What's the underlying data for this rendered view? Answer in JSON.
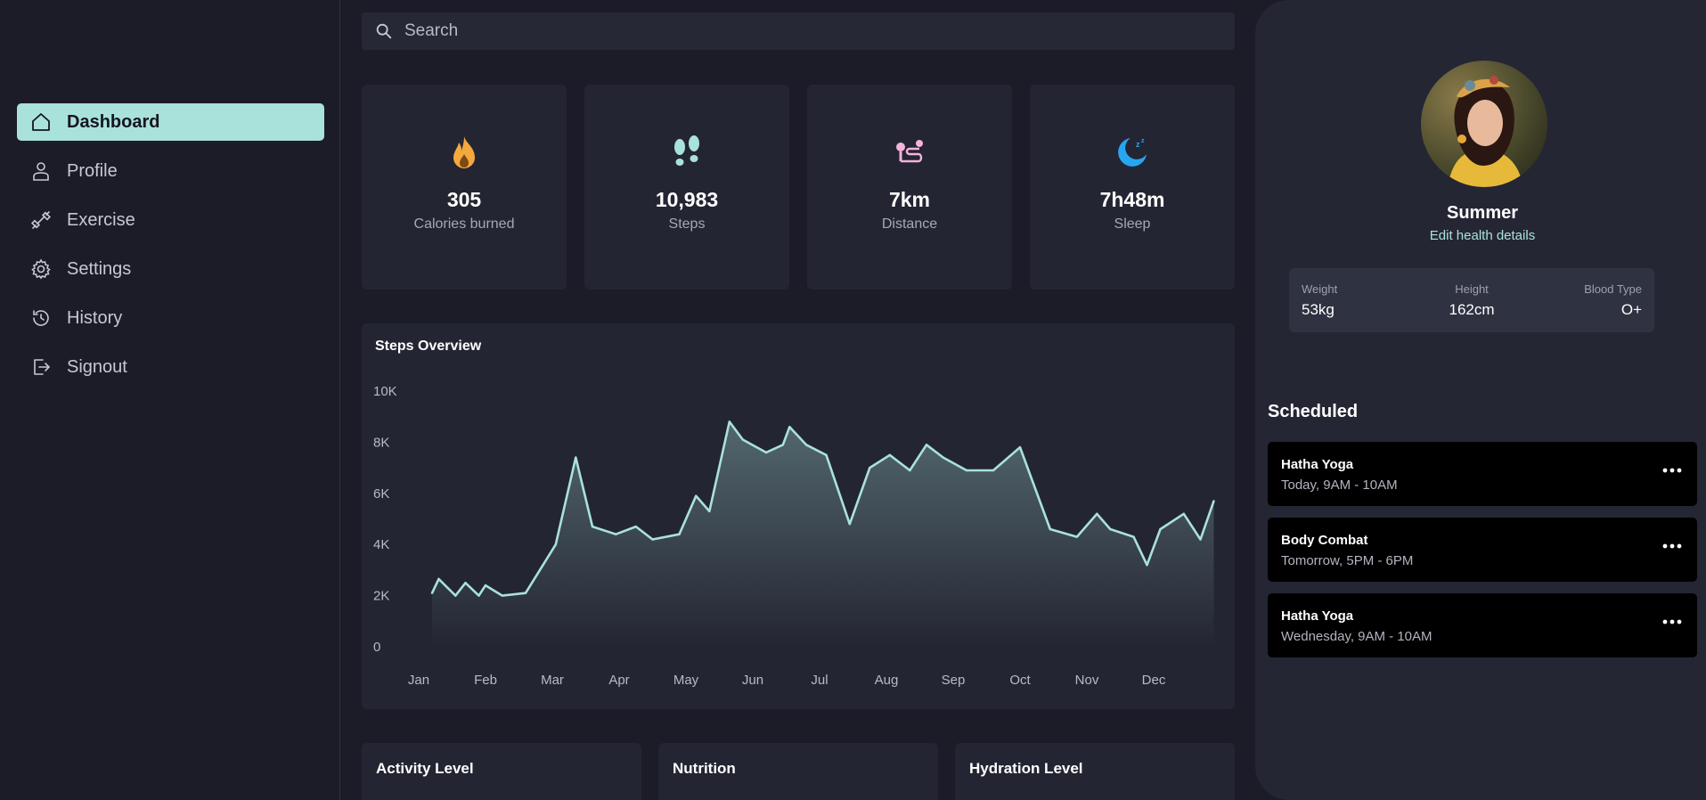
{
  "sidebar": {
    "items": [
      {
        "label": "Dashboard",
        "icon": "home-icon",
        "active": true
      },
      {
        "label": "Profile",
        "icon": "user-icon"
      },
      {
        "label": "Exercise",
        "icon": "dumbbell-icon"
      },
      {
        "label": "Settings",
        "icon": "gear-icon"
      },
      {
        "label": "History",
        "icon": "history-icon"
      },
      {
        "label": "Signout",
        "icon": "signout-icon"
      }
    ]
  },
  "search": {
    "placeholder": "Search",
    "value": ""
  },
  "stats": [
    {
      "value": "305",
      "label": "Calories burned",
      "icon": "flame-icon",
      "color": "#f5a83d"
    },
    {
      "value": "10,983",
      "label": "Steps",
      "icon": "footprints-icon",
      "color": "#a9e2da"
    },
    {
      "value": "7km",
      "label": "Distance",
      "icon": "distance-icon",
      "color": "#f3b3dd"
    },
    {
      "value": "7h48m",
      "label": "Sleep",
      "icon": "moon-sleep-icon",
      "color": "#27a6f0"
    }
  ],
  "steps_overview": {
    "title": "Steps Overview"
  },
  "chart_data": {
    "type": "area",
    "title": "Steps Overview",
    "categories": [
      "Jan",
      "Feb",
      "Mar",
      "Apr",
      "May",
      "Jun",
      "Jul",
      "Aug",
      "Sep",
      "Oct",
      "Nov",
      "Dec"
    ],
    "y_ticks": [
      "10K",
      "8K",
      "6K",
      "4K",
      "2K",
      "0"
    ],
    "ylim": [
      0,
      10000
    ],
    "grid": false,
    "color": "#a9e2da",
    "points": [
      {
        "x": 0.2,
        "y": 2100
      },
      {
        "x": 0.3,
        "y": 2650
      },
      {
        "x": 0.55,
        "y": 2000
      },
      {
        "x": 0.7,
        "y": 2500
      },
      {
        "x": 0.9,
        "y": 2000
      },
      {
        "x": 1.0,
        "y": 2400
      },
      {
        "x": 1.25,
        "y": 2000
      },
      {
        "x": 1.6,
        "y": 2100
      },
      {
        "x": 2.05,
        "y": 4000
      },
      {
        "x": 2.35,
        "y": 7400
      },
      {
        "x": 2.6,
        "y": 4700
      },
      {
        "x": 2.95,
        "y": 4400
      },
      {
        "x": 3.25,
        "y": 4700
      },
      {
        "x": 3.5,
        "y": 4200
      },
      {
        "x": 3.9,
        "y": 4400
      },
      {
        "x": 4.15,
        "y": 5900
      },
      {
        "x": 4.35,
        "y": 5300
      },
      {
        "x": 4.65,
        "y": 8800
      },
      {
        "x": 4.85,
        "y": 8100
      },
      {
        "x": 5.2,
        "y": 7600
      },
      {
        "x": 5.45,
        "y": 7900
      },
      {
        "x": 5.55,
        "y": 8600
      },
      {
        "x": 5.8,
        "y": 7900
      },
      {
        "x": 6.1,
        "y": 7500
      },
      {
        "x": 6.45,
        "y": 4800
      },
      {
        "x": 6.75,
        "y": 7000
      },
      {
        "x": 7.05,
        "y": 7500
      },
      {
        "x": 7.35,
        "y": 6900
      },
      {
        "x": 7.6,
        "y": 7900
      },
      {
        "x": 7.85,
        "y": 7400
      },
      {
        "x": 8.2,
        "y": 6900
      },
      {
        "x": 8.6,
        "y": 6900
      },
      {
        "x": 9.0,
        "y": 7800
      },
      {
        "x": 9.45,
        "y": 4600
      },
      {
        "x": 9.85,
        "y": 4300
      },
      {
        "x": 10.15,
        "y": 5200
      },
      {
        "x": 10.35,
        "y": 4600
      },
      {
        "x": 10.7,
        "y": 4300
      },
      {
        "x": 10.9,
        "y": 3200
      },
      {
        "x": 11.1,
        "y": 4600
      },
      {
        "x": 11.45,
        "y": 5200
      },
      {
        "x": 11.7,
        "y": 4200
      },
      {
        "x": 11.9,
        "y": 5700
      }
    ]
  },
  "bottom_cards": [
    {
      "title": "Activity Level"
    },
    {
      "title": "Nutrition"
    },
    {
      "title": "Hydration Level"
    }
  ],
  "profile": {
    "name": "Summer",
    "edit_label": "Edit health details",
    "health": [
      {
        "label": "Weight",
        "value": "53kg"
      },
      {
        "label": "Height",
        "value": "162cm"
      },
      {
        "label": "Blood Type",
        "value": "O+"
      }
    ]
  },
  "scheduled": {
    "title": "Scheduled",
    "items": [
      {
        "name": "Hatha Yoga",
        "time": "Today, 9AM - 10AM"
      },
      {
        "name": "Body Combat",
        "time": "Tomorrow, 5PM - 6PM"
      },
      {
        "name": "Hatha Yoga",
        "time": "Wednesday, 9AM - 10AM"
      }
    ]
  }
}
